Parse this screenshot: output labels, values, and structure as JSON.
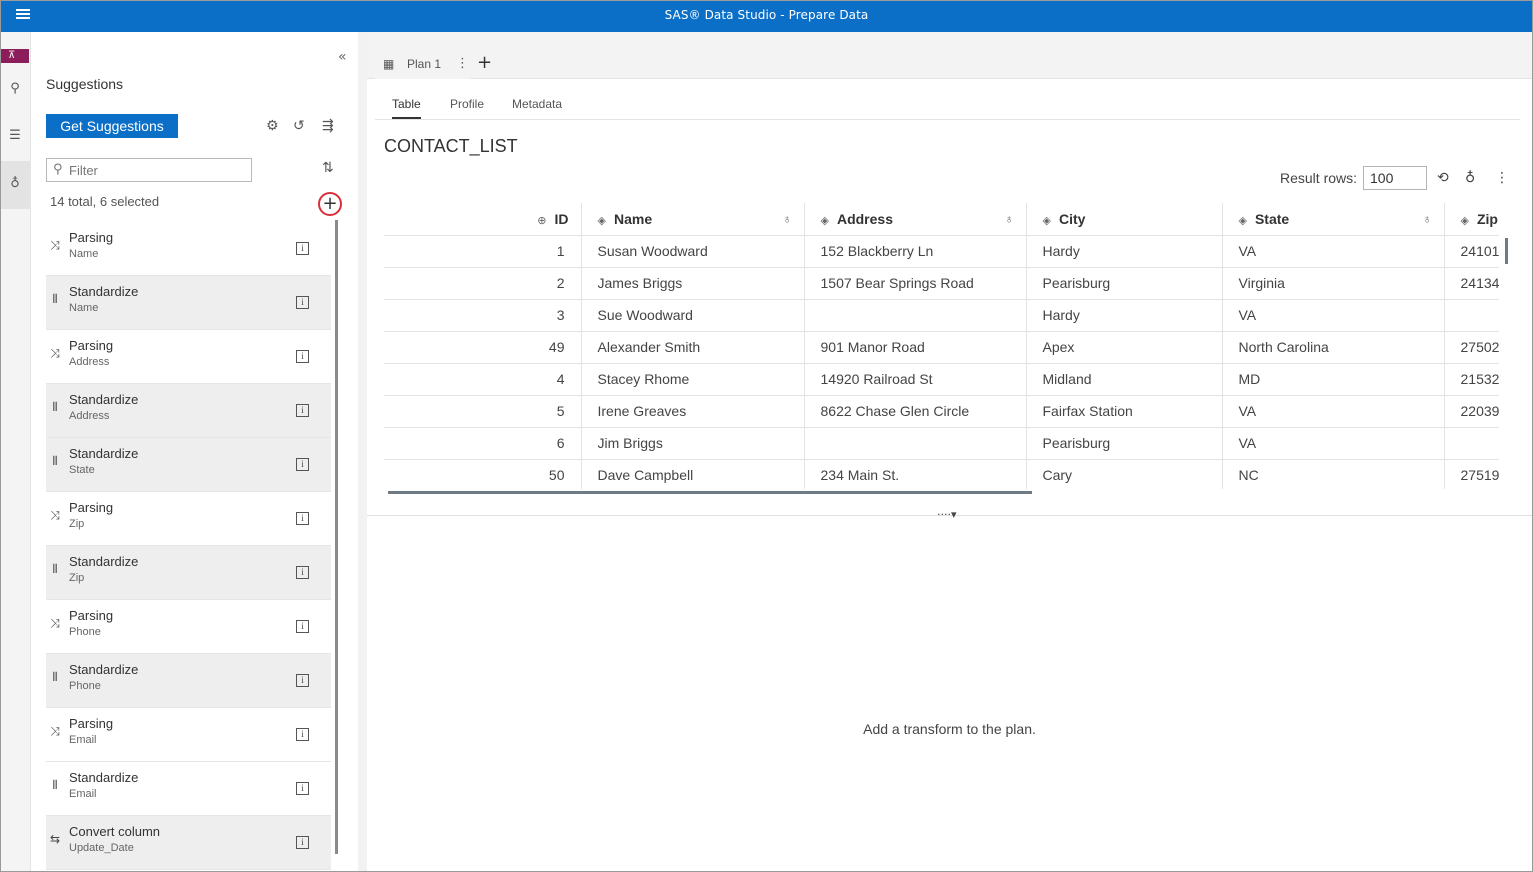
{
  "app": {
    "title": "SAS® Data Studio - Prepare Data"
  },
  "rail": {
    "pin_icon": "pin-icon",
    "items": [
      "transforms-icon",
      "columns-icon",
      "suggestions-icon"
    ]
  },
  "suggestions": {
    "title": "Suggestions",
    "get_button": "Get Suggestions",
    "filter_placeholder": "Filter",
    "count": "14 total, 6 selected",
    "items": [
      {
        "name": "Parsing",
        "column": "Name",
        "icon": "parse-icon"
      },
      {
        "name": "Standardize",
        "column": "Name",
        "icon": "standardize-icon"
      },
      {
        "name": "Parsing",
        "column": "Address",
        "icon": "parse-icon"
      },
      {
        "name": "Standardize",
        "column": "Address",
        "icon": "standardize-icon"
      },
      {
        "name": "Standardize",
        "column": "State",
        "icon": "standardize-icon"
      },
      {
        "name": "Parsing",
        "column": "Zip",
        "icon": "parse-icon"
      },
      {
        "name": "Standardize",
        "column": "Zip",
        "icon": "standardize-icon"
      },
      {
        "name": "Parsing",
        "column": "Phone",
        "icon": "parse-icon"
      },
      {
        "name": "Standardize",
        "column": "Phone",
        "icon": "standardize-icon"
      },
      {
        "name": "Parsing",
        "column": "Email",
        "icon": "parse-icon"
      },
      {
        "name": "Standardize",
        "column": "Email",
        "icon": "standardize-icon"
      },
      {
        "name": "Convert column",
        "column": "Update_Date",
        "icon": "convert-icon"
      }
    ]
  },
  "plan": {
    "tab_name": "Plan 1",
    "subtabs": [
      "Table",
      "Profile",
      "Metadata"
    ],
    "active_subtab": "Table",
    "table_name": "CONTACT_LIST",
    "result_rows_label": "Result rows:",
    "result_rows_value": "100",
    "columns": [
      "ID",
      "Name",
      "Address",
      "City",
      "State",
      "Zip"
    ],
    "rows": [
      [
        "1",
        "Susan Woodward",
        "152 Blackberry Ln",
        "Hardy",
        "VA",
        "24101"
      ],
      [
        "2",
        "James Briggs",
        "1507 Bear Springs Road",
        "Pearisburg",
        "Virginia",
        "24134"
      ],
      [
        "3",
        "Sue Woodward",
        "",
        "Hardy",
        "VA",
        ""
      ],
      [
        "49",
        "Alexander Smith",
        "901 Manor Road",
        "Apex",
        "North Carolina",
        "27502"
      ],
      [
        "4",
        "Stacey Rhome",
        "14920 Railroad St",
        "Midland",
        "MD",
        "21532"
      ],
      [
        "5",
        "Irene Greaves",
        "8622 Chase Glen Circle",
        "Fairfax Station",
        "VA",
        "22039"
      ],
      [
        "6",
        "Jim Briggs",
        "",
        "Pearisburg",
        "VA",
        ""
      ],
      [
        "50",
        "Dave Campbell",
        "234 Main St.",
        "Cary",
        "NC",
        "27519"
      ]
    ],
    "empty_message": "Add a transform to the plan."
  },
  "colors": {
    "brand": "#0b6fc8",
    "pin": "#8b1e5a",
    "highlight": "#d9303a"
  }
}
